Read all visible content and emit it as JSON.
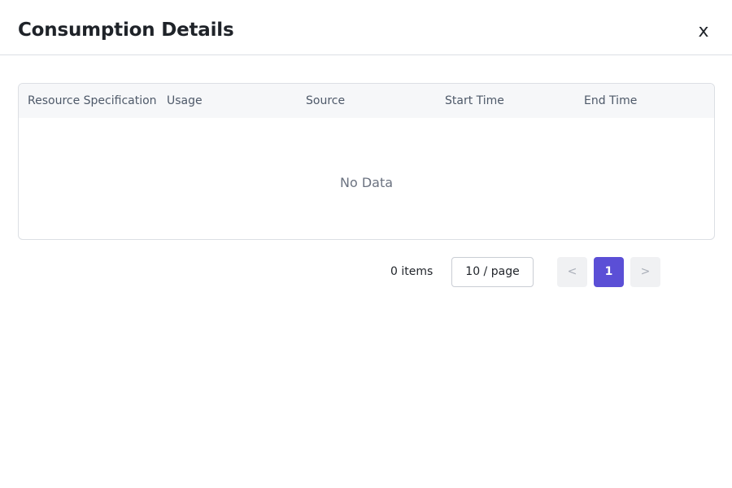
{
  "header": {
    "title": "Consumption Details",
    "close_label": "x"
  },
  "table": {
    "columns": [
      "Resource Specification",
      "Usage",
      "Source",
      "Start Time",
      "End Time"
    ],
    "rows": [],
    "empty_text": "No Data"
  },
  "pagination": {
    "total_text": "0 items",
    "page_size": "10 / page",
    "prev_label": "<",
    "current_page": "1",
    "next_label": ">",
    "accent_color": "#5b4fd6"
  }
}
